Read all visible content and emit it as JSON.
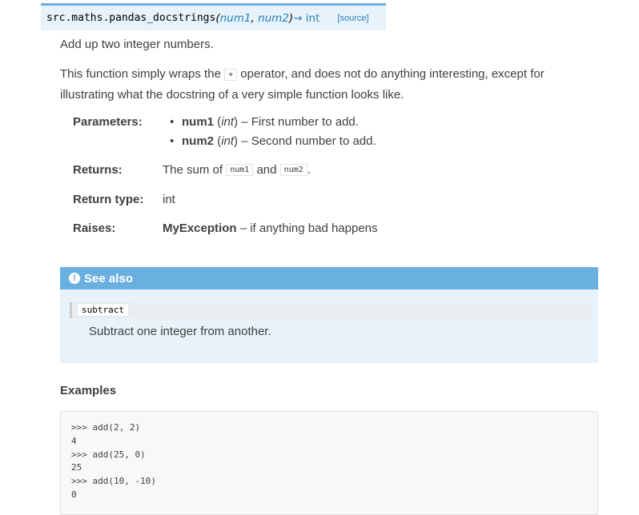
{
  "signature": {
    "name": "src.maths.pandas_docstrings",
    "open_paren": "(",
    "param1": "num1",
    "sep": ", ",
    "param2": "num2",
    "close_paren": ")",
    "arrow_return": "→ int",
    "source_link": "[source]"
  },
  "summary": "Add up two integer numbers.",
  "description": {
    "before": "This function simply wraps the ",
    "operator": "+",
    "after": " operator, and does not do anything interesting, except for illustrating what the docstring of a very simple function looks like."
  },
  "fields": {
    "parameters_label": "Parameters:",
    "params": [
      {
        "name": "num1",
        "type": "int",
        "desc": " – First number to add."
      },
      {
        "name": "num2",
        "type": "int",
        "desc": " – Second number to add."
      }
    ],
    "returns_label": "Returns:",
    "returns": {
      "before": "The sum of ",
      "code1": "num1",
      "mid": " and ",
      "code2": "num2",
      "after": "."
    },
    "return_type_label": "Return type:",
    "return_type": "int",
    "raises_label": "Raises:",
    "raises": {
      "name": "MyException",
      "desc": " – if anything bad happens"
    }
  },
  "see_also": {
    "title": "See also",
    "icon": "info-icon",
    "item": "subtract",
    "item_desc": "Subtract one integer from another."
  },
  "examples": {
    "heading": "Examples",
    "lines": [
      ">>> add(2, 2)",
      "4",
      ">>> add(25, 0)",
      "25",
      ">>> add(10, -10)",
      "0"
    ]
  },
  "colors": {
    "accent": "#6ab0de",
    "link": "#2980b9",
    "admonition_bg": "#e7f2fa"
  }
}
